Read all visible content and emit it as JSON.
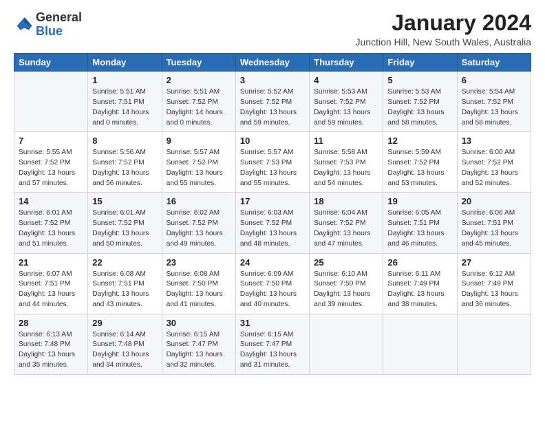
{
  "logo": {
    "general": "General",
    "blue": "Blue"
  },
  "header": {
    "month": "January 2024",
    "location": "Junction Hill, New South Wales, Australia"
  },
  "weekdays": [
    "Sunday",
    "Monday",
    "Tuesday",
    "Wednesday",
    "Thursday",
    "Friday",
    "Saturday"
  ],
  "weeks": [
    [
      {
        "day": "",
        "info": ""
      },
      {
        "day": "1",
        "info": "Sunrise: 5:51 AM\nSunset: 7:51 PM\nDaylight: 14 hours\nand 0 minutes."
      },
      {
        "day": "2",
        "info": "Sunrise: 5:51 AM\nSunset: 7:52 PM\nDaylight: 14 hours\nand 0 minutes."
      },
      {
        "day": "3",
        "info": "Sunrise: 5:52 AM\nSunset: 7:52 PM\nDaylight: 13 hours\nand 59 minutes."
      },
      {
        "day": "4",
        "info": "Sunrise: 5:53 AM\nSunset: 7:52 PM\nDaylight: 13 hours\nand 59 minutes."
      },
      {
        "day": "5",
        "info": "Sunrise: 5:53 AM\nSunset: 7:52 PM\nDaylight: 13 hours\nand 58 minutes."
      },
      {
        "day": "6",
        "info": "Sunrise: 5:54 AM\nSunset: 7:52 PM\nDaylight: 13 hours\nand 58 minutes."
      }
    ],
    [
      {
        "day": "7",
        "info": "Sunrise: 5:55 AM\nSunset: 7:52 PM\nDaylight: 13 hours\nand 57 minutes."
      },
      {
        "day": "8",
        "info": "Sunrise: 5:56 AM\nSunset: 7:52 PM\nDaylight: 13 hours\nand 56 minutes."
      },
      {
        "day": "9",
        "info": "Sunrise: 5:57 AM\nSunset: 7:52 PM\nDaylight: 13 hours\nand 55 minutes."
      },
      {
        "day": "10",
        "info": "Sunrise: 5:57 AM\nSunset: 7:53 PM\nDaylight: 13 hours\nand 55 minutes."
      },
      {
        "day": "11",
        "info": "Sunrise: 5:58 AM\nSunset: 7:53 PM\nDaylight: 13 hours\nand 54 minutes."
      },
      {
        "day": "12",
        "info": "Sunrise: 5:59 AM\nSunset: 7:52 PM\nDaylight: 13 hours\nand 53 minutes."
      },
      {
        "day": "13",
        "info": "Sunrise: 6:00 AM\nSunset: 7:52 PM\nDaylight: 13 hours\nand 52 minutes."
      }
    ],
    [
      {
        "day": "14",
        "info": "Sunrise: 6:01 AM\nSunset: 7:52 PM\nDaylight: 13 hours\nand 51 minutes."
      },
      {
        "day": "15",
        "info": "Sunrise: 6:01 AM\nSunset: 7:52 PM\nDaylight: 13 hours\nand 50 minutes."
      },
      {
        "day": "16",
        "info": "Sunrise: 6:02 AM\nSunset: 7:52 PM\nDaylight: 13 hours\nand 49 minutes."
      },
      {
        "day": "17",
        "info": "Sunrise: 6:03 AM\nSunset: 7:52 PM\nDaylight: 13 hours\nand 48 minutes."
      },
      {
        "day": "18",
        "info": "Sunrise: 6:04 AM\nSunset: 7:52 PM\nDaylight: 13 hours\nand 47 minutes."
      },
      {
        "day": "19",
        "info": "Sunrise: 6:05 AM\nSunset: 7:51 PM\nDaylight: 13 hours\nand 46 minutes."
      },
      {
        "day": "20",
        "info": "Sunrise: 6:06 AM\nSunset: 7:51 PM\nDaylight: 13 hours\nand 45 minutes."
      }
    ],
    [
      {
        "day": "21",
        "info": "Sunrise: 6:07 AM\nSunset: 7:51 PM\nDaylight: 13 hours\nand 44 minutes."
      },
      {
        "day": "22",
        "info": "Sunrise: 6:08 AM\nSunset: 7:51 PM\nDaylight: 13 hours\nand 43 minutes."
      },
      {
        "day": "23",
        "info": "Sunrise: 6:08 AM\nSunset: 7:50 PM\nDaylight: 13 hours\nand 41 minutes."
      },
      {
        "day": "24",
        "info": "Sunrise: 6:09 AM\nSunset: 7:50 PM\nDaylight: 13 hours\nand 40 minutes."
      },
      {
        "day": "25",
        "info": "Sunrise: 6:10 AM\nSunset: 7:50 PM\nDaylight: 13 hours\nand 39 minutes."
      },
      {
        "day": "26",
        "info": "Sunrise: 6:11 AM\nSunset: 7:49 PM\nDaylight: 13 hours\nand 38 minutes."
      },
      {
        "day": "27",
        "info": "Sunrise: 6:12 AM\nSunset: 7:49 PM\nDaylight: 13 hours\nand 36 minutes."
      }
    ],
    [
      {
        "day": "28",
        "info": "Sunrise: 6:13 AM\nSunset: 7:48 PM\nDaylight: 13 hours\nand 35 minutes."
      },
      {
        "day": "29",
        "info": "Sunrise: 6:14 AM\nSunset: 7:48 PM\nDaylight: 13 hours\nand 34 minutes."
      },
      {
        "day": "30",
        "info": "Sunrise: 6:15 AM\nSunset: 7:47 PM\nDaylight: 13 hours\nand 32 minutes."
      },
      {
        "day": "31",
        "info": "Sunrise: 6:15 AM\nSunset: 7:47 PM\nDaylight: 13 hours\nand 31 minutes."
      },
      {
        "day": "",
        "info": ""
      },
      {
        "day": "",
        "info": ""
      },
      {
        "day": "",
        "info": ""
      }
    ]
  ]
}
